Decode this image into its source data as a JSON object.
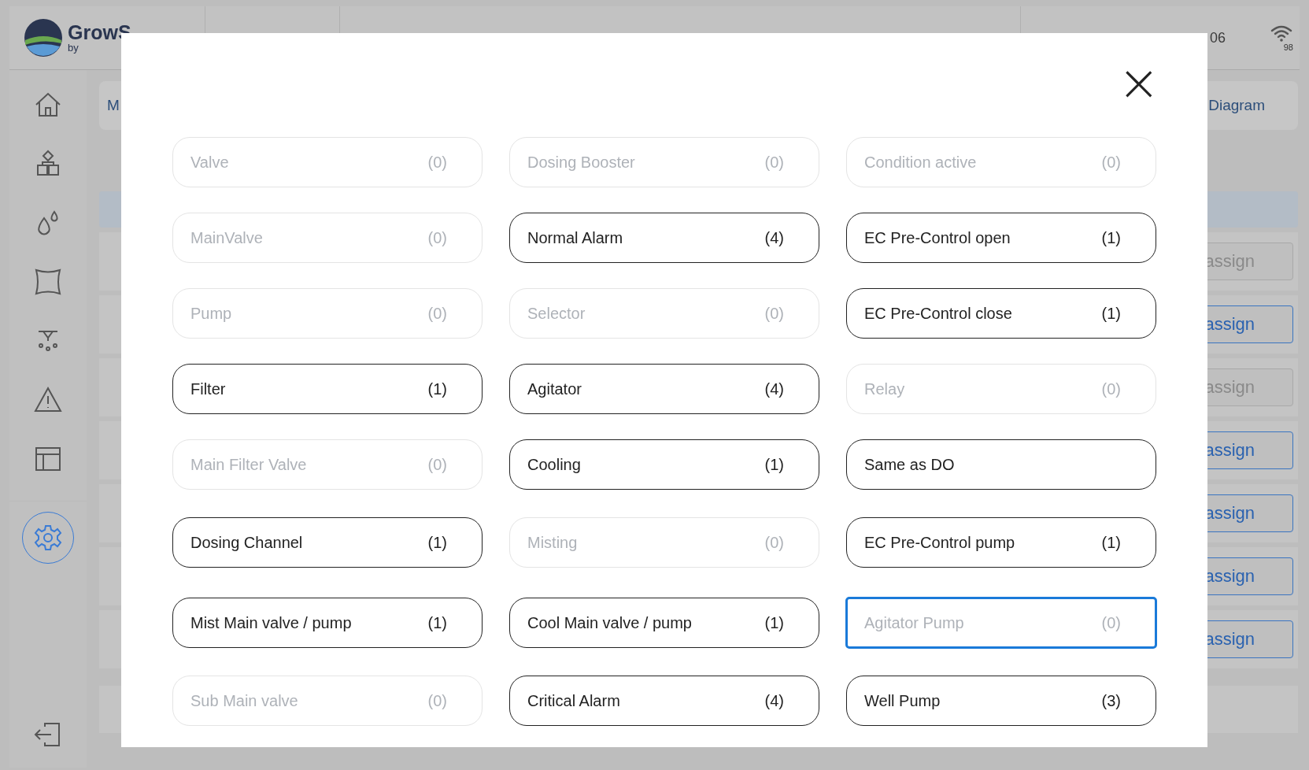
{
  "header": {
    "logo_text": "GrowS",
    "logo_sub": "by",
    "time_fragment": "06",
    "wifi_reading": "98"
  },
  "sidebar": {
    "items": [
      {
        "selected": false
      },
      {
        "selected": false
      },
      {
        "selected": false
      },
      {
        "selected": false
      },
      {
        "selected": false
      },
      {
        "selected": false
      },
      {
        "selected": false
      },
      {
        "selected": true
      }
    ]
  },
  "tabs": [
    {
      "label": "M"
    },
    {
      "label": "Diagram"
    }
  ],
  "assign_buttons": [
    {
      "label": "assign",
      "disabled": true
    },
    {
      "label": "assign",
      "disabled": false
    },
    {
      "label": "assign",
      "disabled": true
    },
    {
      "label": "assign",
      "disabled": false
    },
    {
      "label": "assign",
      "disabled": false
    },
    {
      "label": "assign",
      "disabled": false
    },
    {
      "label": "assign",
      "disabled": false
    }
  ],
  "dialog": {
    "close": "×",
    "items": [
      {
        "label": "Valve",
        "count": "(0)",
        "enabled": false,
        "focused": false
      },
      {
        "label": "Dosing Booster",
        "count": "(0)",
        "enabled": false,
        "focused": false
      },
      {
        "label": "Condition active",
        "count": "(0)",
        "enabled": false,
        "focused": false
      },
      {
        "label": "MainValve",
        "count": "(0)",
        "enabled": false,
        "focused": false
      },
      {
        "label": "Normal Alarm",
        "count": "(4)",
        "enabled": true,
        "focused": false
      },
      {
        "label": "EC Pre-Control open",
        "count": "(1)",
        "enabled": true,
        "focused": false
      },
      {
        "label": "Pump",
        "count": "(0)",
        "enabled": false,
        "focused": false
      },
      {
        "label": "Selector",
        "count": "(0)",
        "enabled": false,
        "focused": false
      },
      {
        "label": "EC Pre-Control close",
        "count": "(1)",
        "enabled": true,
        "focused": false
      },
      {
        "label": "Filter",
        "count": "(1)",
        "enabled": true,
        "focused": false
      },
      {
        "label": "Agitator",
        "count": "(4)",
        "enabled": true,
        "focused": false
      },
      {
        "label": "Relay",
        "count": "(0)",
        "enabled": false,
        "focused": false
      },
      {
        "label": "Main Filter Valve",
        "count": "(0)",
        "enabled": false,
        "focused": false
      },
      {
        "label": "Cooling",
        "count": "(1)",
        "enabled": true,
        "focused": false
      },
      {
        "label": "Same as DO",
        "enabled": true,
        "focused": false
      },
      {
        "label": "Dosing Channel",
        "count": "(1)",
        "enabled": true,
        "focused": false
      },
      {
        "label": "Misting",
        "count": "(0)",
        "enabled": false,
        "focused": false
      },
      {
        "label": "EC Pre-Control pump",
        "count": "(1)",
        "enabled": true,
        "focused": false
      },
      {
        "label": "Mist Main valve / pump",
        "count": "(1)",
        "enabled": true,
        "focused": false
      },
      {
        "label": "Cool Main valve / pump",
        "count": "(1)",
        "enabled": true,
        "focused": false
      },
      {
        "label": "Agitator Pump",
        "count": "(0)",
        "enabled": false,
        "focused": true
      },
      {
        "label": "Sub Main valve",
        "count": "(0)",
        "enabled": false,
        "focused": false
      },
      {
        "label": "Critical Alarm",
        "count": "(4)",
        "enabled": true,
        "focused": false
      },
      {
        "label": "Well Pump",
        "count": "(3)",
        "enabled": true,
        "focused": false
      }
    ]
  }
}
